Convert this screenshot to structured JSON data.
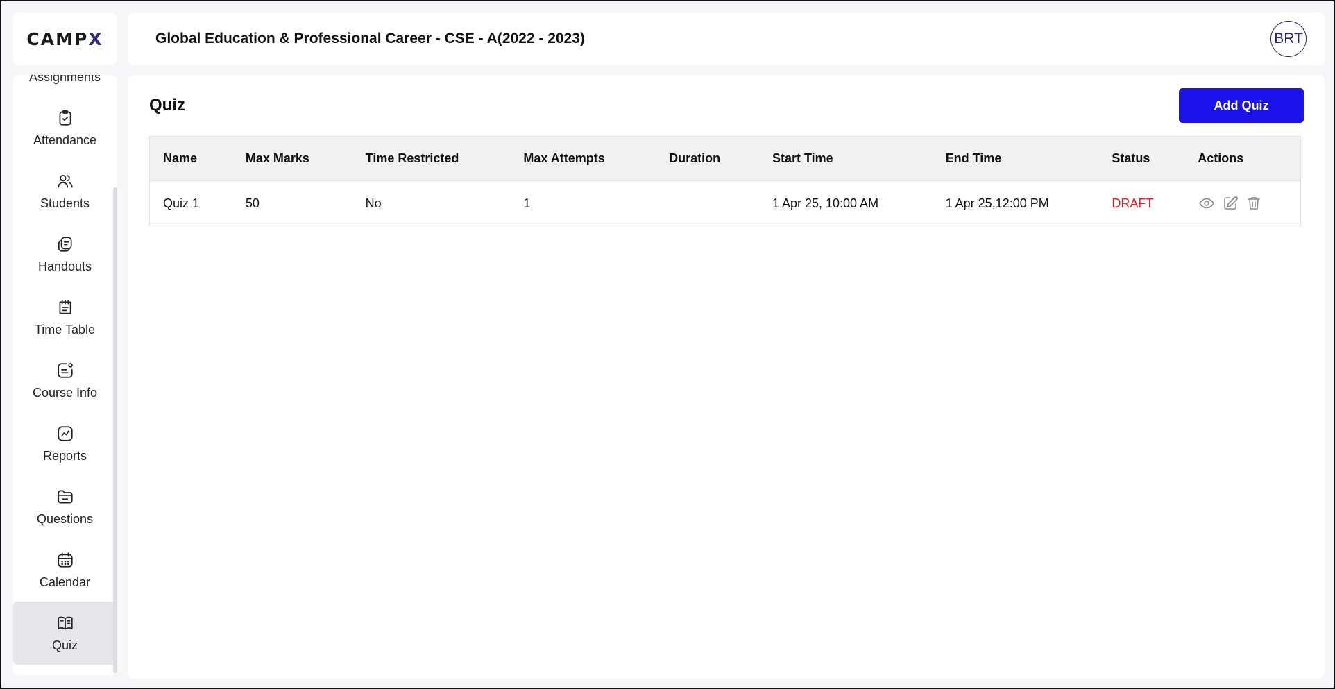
{
  "brand": {
    "logo_main": "CAMP",
    "logo_accent": "X"
  },
  "header": {
    "title": "Global Education & Professional Career - CSE - A(2022 - 2023)",
    "avatar": "BRT"
  },
  "sidebar": {
    "items": [
      {
        "label": "Assignments",
        "icon": "book-open-icon"
      },
      {
        "label": "Attendance",
        "icon": "clipboard-check-icon"
      },
      {
        "label": "Students",
        "icon": "users-icon"
      },
      {
        "label": "Handouts",
        "icon": "handout-icon"
      },
      {
        "label": "Time Table",
        "icon": "timetable-icon"
      },
      {
        "label": "Course Info",
        "icon": "course-info-icon"
      },
      {
        "label": "Reports",
        "icon": "chart-icon"
      },
      {
        "label": "Questions",
        "icon": "folder-icon"
      },
      {
        "label": "Calendar",
        "icon": "calendar-icon"
      },
      {
        "label": "Quiz",
        "icon": "book-icon",
        "active": true
      }
    ]
  },
  "main": {
    "title": "Quiz",
    "add_button": "Add Quiz",
    "table": {
      "headers": [
        "Name",
        "Max Marks",
        "Time Restricted",
        "Max Attempts",
        "Duration",
        "Start Time",
        "End Time",
        "Status",
        "Actions"
      ],
      "rows": [
        {
          "name": "Quiz 1",
          "max_marks": "50",
          "time_restricted": "No",
          "max_attempts": "1",
          "duration": "",
          "start_time": "1 Apr 25, 10:00 AM",
          "end_time": "1 Apr 25,12:00 PM",
          "status": "DRAFT"
        }
      ]
    }
  },
  "colors": {
    "primary": "#1c12ea",
    "draft": "#e01e2a",
    "logo_accent": "#2e2c7e"
  }
}
